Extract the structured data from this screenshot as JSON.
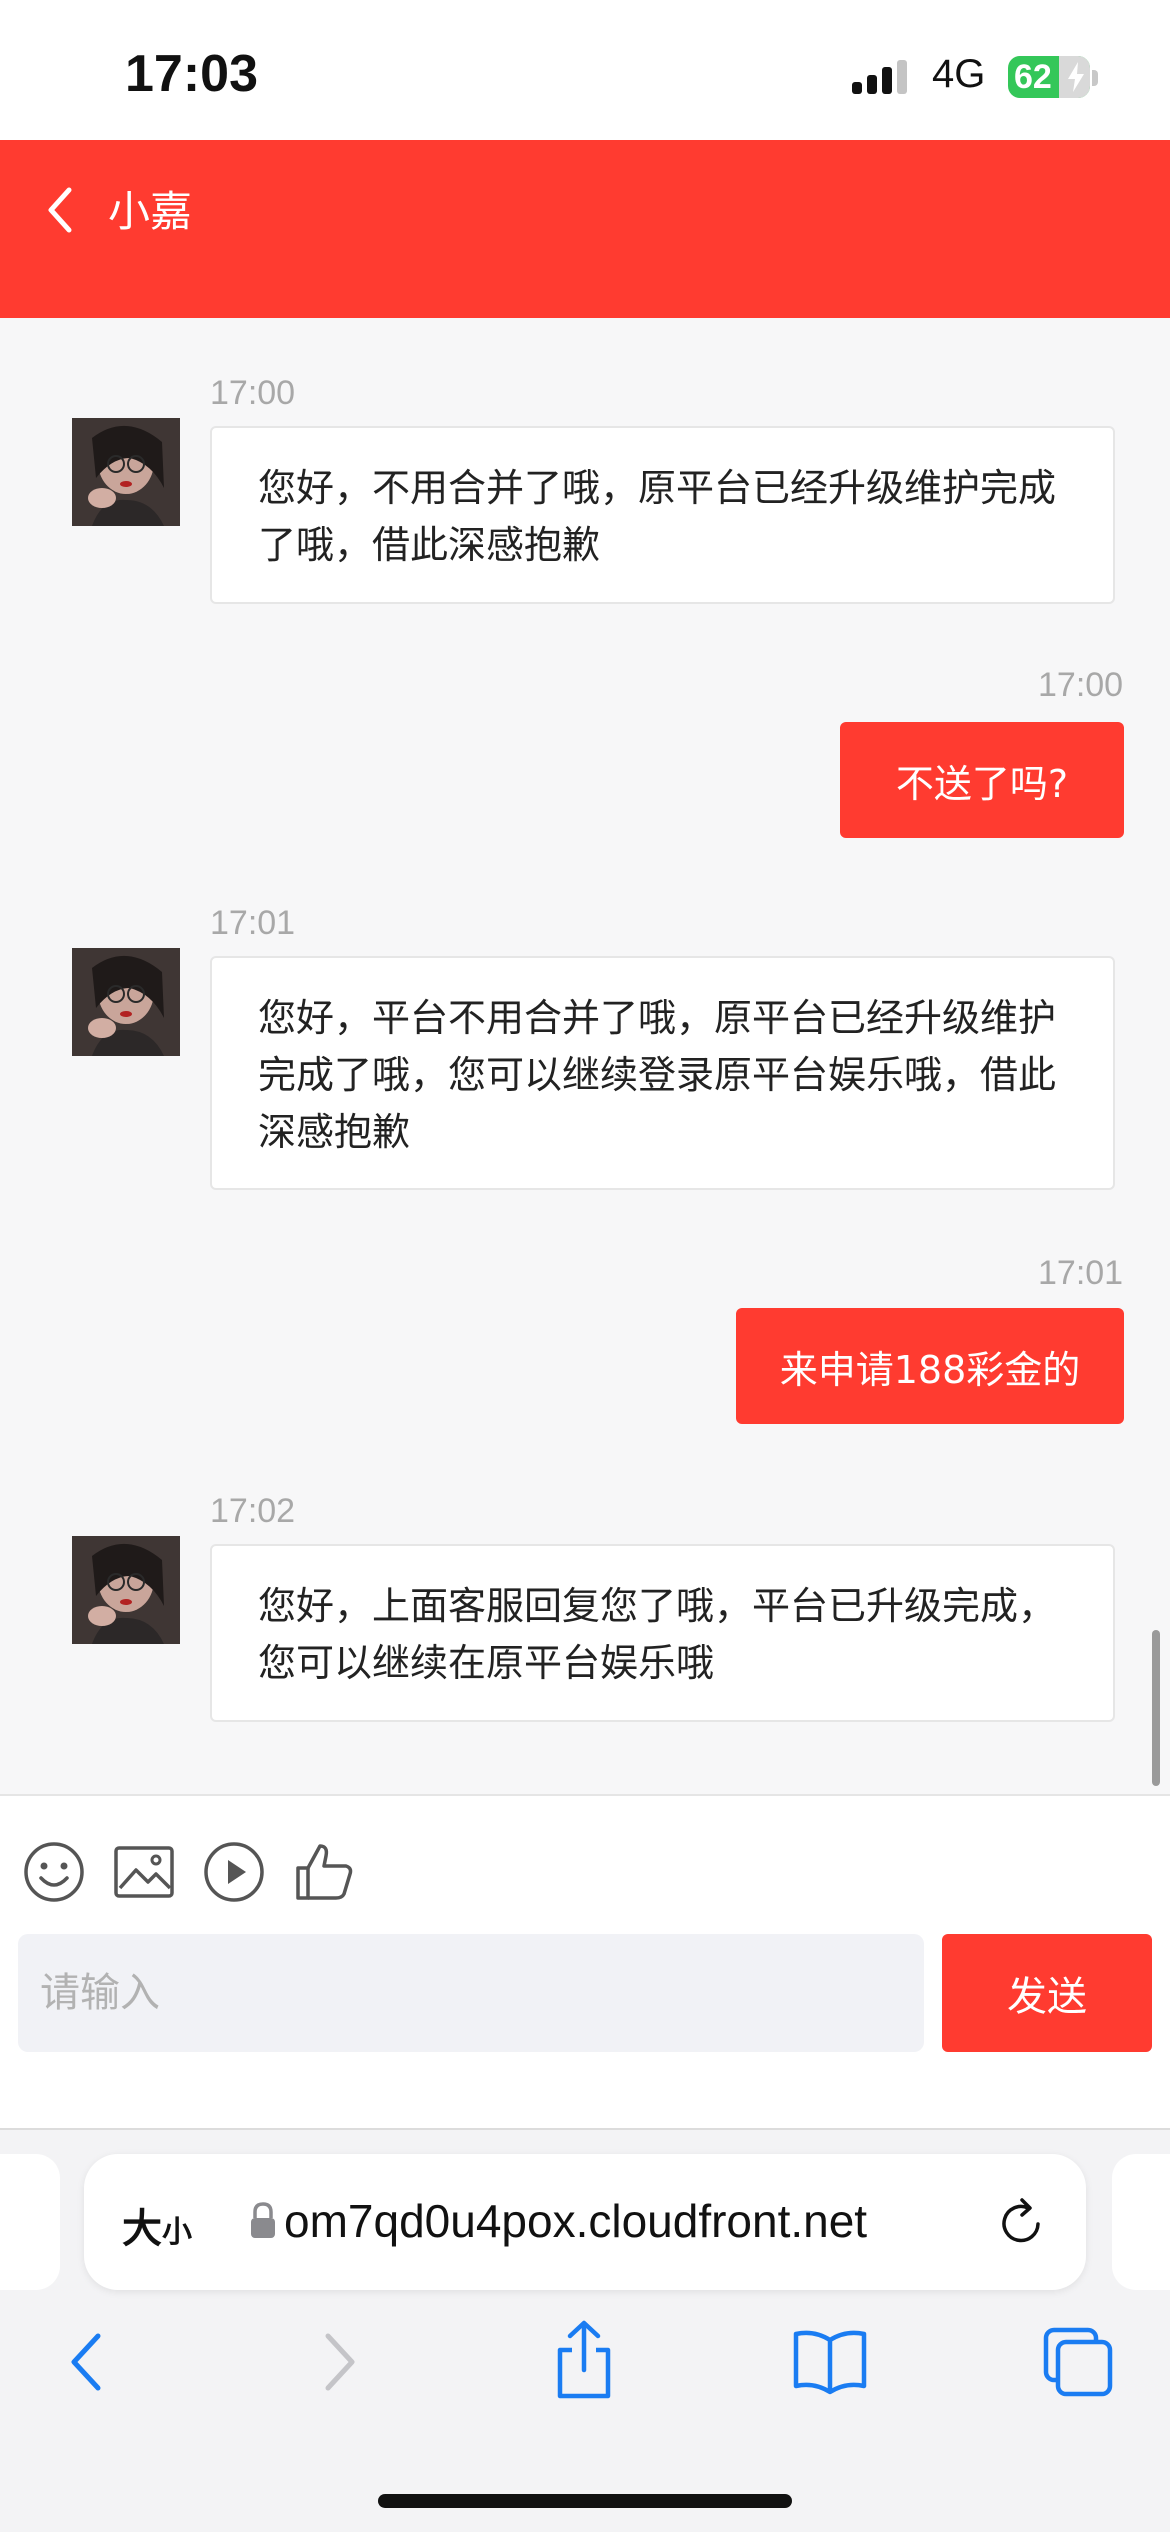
{
  "status_bar": {
    "time": "17:03",
    "network": "4G",
    "battery_level": "62",
    "battery_color": "#34c759"
  },
  "header": {
    "title": "小嘉",
    "back_icon": "chevron-left-icon",
    "background": "#ff3b30"
  },
  "messages": [
    {
      "direction": "incoming",
      "time": "17:00",
      "text": "您好，不用合并了哦，原平台已经升级维护完成了哦，借此深感抱歉"
    },
    {
      "direction": "outgoing",
      "time": "17:00",
      "text": "不送了吗?"
    },
    {
      "direction": "incoming",
      "time": "17:01",
      "text": "您好，平台不用合并了哦，原平台已经升级维护完成了哦，您可以继续登录原平台娱乐哦，借此深感抱歉"
    },
    {
      "direction": "outgoing",
      "time": "17:01",
      "text": "来申请188彩金的"
    },
    {
      "direction": "incoming",
      "time": "17:02",
      "text": "您好，上面客服回复您了哦，平台已升级完成，您可以继续在原平台娱乐哦"
    }
  ],
  "toolbar": {
    "icons": [
      "emoji-icon",
      "image-icon",
      "video-icon",
      "thumbs-up-icon"
    ]
  },
  "composer": {
    "placeholder": "请输入",
    "send_label": "发送"
  },
  "browser": {
    "text_size_label_big": "大",
    "text_size_label_small": "小",
    "url": "om7qd0u4pox.cloudfront.net",
    "icons": [
      "back-icon",
      "forward-icon",
      "share-icon",
      "bookmarks-icon",
      "tabs-icon"
    ],
    "accent": "#1a7cf2"
  }
}
